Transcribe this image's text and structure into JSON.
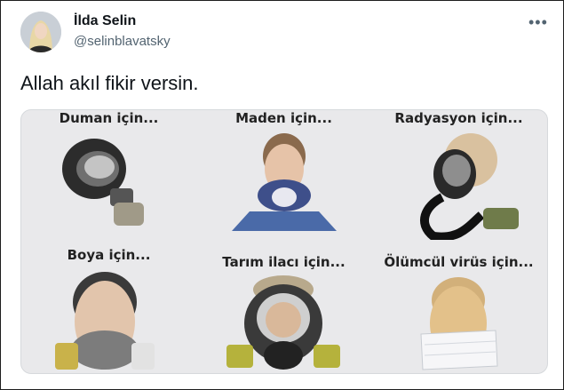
{
  "tweet": {
    "author_name": "İlda Selin",
    "author_handle": "@selinblavatsky",
    "more_icon": "more-horizontal-icon",
    "text": "Allah akıl fikir versin."
  },
  "media": {
    "captions": [
      "Duman için...",
      "Maden için...",
      "Radyasyon için...",
      "Boya için...",
      "Tarım ilacı için...",
      "Ölümcül virüs için..."
    ]
  }
}
